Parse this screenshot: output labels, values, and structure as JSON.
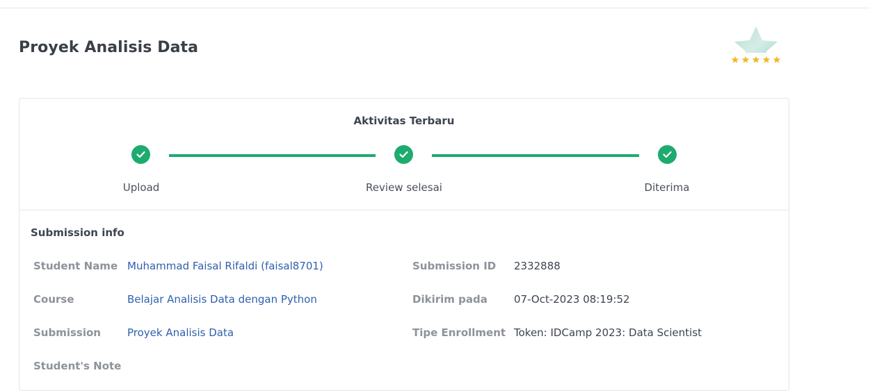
{
  "page": {
    "title": "Proyek Analisis Data"
  },
  "activity": {
    "title": "Aktivitas Terbaru",
    "steps": [
      {
        "label": "Upload",
        "status": "done"
      },
      {
        "label": "Review selesai",
        "status": "done"
      },
      {
        "label": "Diterima",
        "status": "done"
      }
    ]
  },
  "submission_info": {
    "title": "Submission info",
    "student_name_label": "Student Name",
    "student_name_value": "Muhammad Faisal Rifaldi (faisal8701)",
    "course_label": "Course",
    "course_value": "Belajar Analisis Data dengan Python",
    "submission_label": "Submission",
    "submission_value": "Proyek Analisis Data",
    "student_note_label": "Student's Note",
    "submission_id_label": "Submission ID",
    "submission_id_value": "2332888",
    "submitted_at_label": "Dikirim pada",
    "submitted_at_value": "07-Oct-2023 08:19:52",
    "enrollment_type_label": "Tipe Enrollment",
    "enrollment_type_value": "Token: IDCamp 2023: Data Scientist"
  },
  "badge": {
    "icon": "star-rating-badge-icon",
    "stars": 5
  },
  "colors": {
    "accent": "#1dab6f",
    "link": "#2f5fae",
    "label": "#8d929b",
    "text": "#3d4450"
  }
}
